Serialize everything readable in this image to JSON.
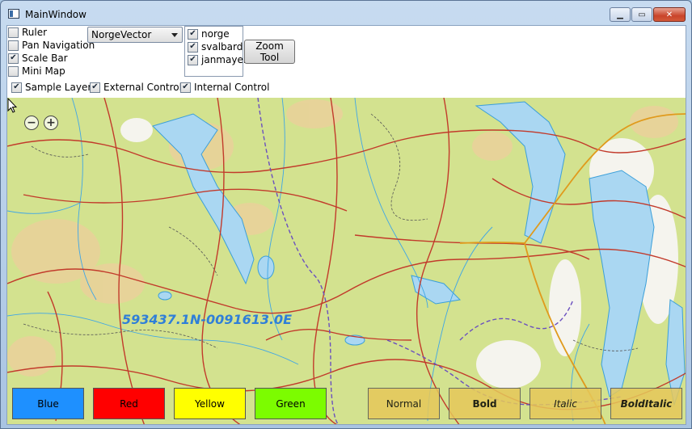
{
  "window": {
    "title": "MainWindow"
  },
  "controls": {
    "ruler": {
      "label": "Ruler",
      "checked": false
    },
    "pan_navigation": {
      "label": "Pan Navigation",
      "checked": false
    },
    "scale_bar": {
      "label": "Scale Bar",
      "checked": true
    },
    "mini_map": {
      "label": "Mini Map",
      "checked": false
    },
    "map_selector": {
      "value": "NorgeVector"
    },
    "layers": [
      {
        "label": "norge",
        "checked": true
      },
      {
        "label": "svalbard",
        "checked": true
      },
      {
        "label": "janmayen",
        "checked": true
      }
    ],
    "zoom_tool_label": "Zoom Tool",
    "sample_layer": {
      "label": "Sample Layer",
      "checked": true
    },
    "external_control": {
      "label": "External Control",
      "checked": true
    },
    "internal_control": {
      "label": "Internal Control",
      "checked": true
    }
  },
  "map": {
    "coordinate_readout": "593437.1N-0091613.0E",
    "zoom_out_symbol": "−",
    "zoom_in_symbol": "+"
  },
  "color_buttons": [
    {
      "label": "Blue",
      "color": "#1e90ff"
    },
    {
      "label": "Red",
      "color": "#ff0000"
    },
    {
      "label": "Yellow",
      "color": "#ffff00"
    },
    {
      "label": "Green",
      "color": "#7cfc00"
    }
  ],
  "font_buttons": [
    {
      "label": "Normal",
      "style": "normal"
    },
    {
      "label": "Bold",
      "style": "bold"
    },
    {
      "label": "Italic",
      "style": "italic"
    },
    {
      "label": "BoldItalic",
      "style": "bolditalic"
    }
  ],
  "font_button_color": "#e6c85a"
}
